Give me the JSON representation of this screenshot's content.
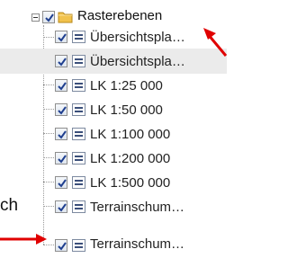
{
  "tree": {
    "root": {
      "label": "Rasterebenen",
      "expanded": true,
      "checked": true,
      "icon": "folder-icon"
    },
    "items": [
      {
        "label": "Übersichtspla…",
        "checked": true,
        "icon": "raster-layer-icon",
        "selected": false
      },
      {
        "label": "Übersichtspla…",
        "checked": true,
        "icon": "raster-layer-icon",
        "selected": true
      },
      {
        "label": "LK 1:25 000",
        "checked": true,
        "icon": "raster-layer-icon",
        "selected": false
      },
      {
        "label": "LK 1:50 000",
        "checked": true,
        "icon": "raster-layer-icon",
        "selected": false
      },
      {
        "label": "LK 1:100 000",
        "checked": true,
        "icon": "raster-layer-icon",
        "selected": false
      },
      {
        "label": "LK 1:200 000",
        "checked": true,
        "icon": "raster-layer-icon",
        "selected": false
      },
      {
        "label": "LK 1:500 000",
        "checked": true,
        "icon": "raster-layer-icon",
        "selected": false
      },
      {
        "label": "Terrainschum…",
        "checked": true,
        "icon": "raster-layer-icon",
        "selected": false
      }
    ]
  },
  "annotation": {
    "text": "ch"
  },
  "colors": {
    "check": "#1f3f8f",
    "folder": "#f1c24d",
    "arrow": "#e00000",
    "selection": "#ebebeb"
  }
}
